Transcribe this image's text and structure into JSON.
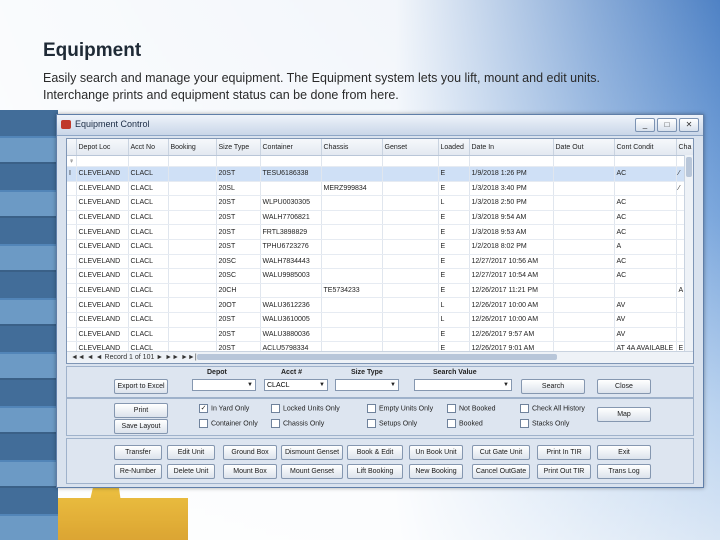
{
  "slide": {
    "title": "Equipment",
    "description": "Easily search and manage your equipment. The Equipment system lets you lift, mount and edit units. Interchange prints and equipment status can be done from here."
  },
  "window": {
    "title": "Equipment Control",
    "controls": [
      "_",
      "□",
      "✕"
    ]
  },
  "grid": {
    "columns": [
      "",
      "Depot Loc",
      "Acct No",
      "Booking",
      "Size Type",
      "Container",
      "Chassis",
      "Genset",
      "Loaded",
      "Date In",
      "Date Out",
      "Cont Condit",
      "Cha"
    ],
    "filter_marker": "♀",
    "rows": [
      [
        "I",
        "CLEVELAND",
        "CLACL",
        "",
        "20ST",
        "TESU6186338",
        "",
        "",
        "E",
        "1/9/2018 1:26 PM",
        "",
        "AC",
        "⁄"
      ],
      [
        "",
        "CLEVELAND",
        "CLACL",
        "",
        "20SL",
        "",
        "MERZ999834",
        "",
        "E",
        "1/3/2018 3:40 PM",
        "",
        "",
        "⁄"
      ],
      [
        "",
        "CLEVELAND",
        "CLACL",
        "",
        "20ST",
        "WLPU0030305",
        "",
        "",
        "L",
        "1/3/2018 2:50 PM",
        "",
        "AC",
        ""
      ],
      [
        "",
        "CLEVELAND",
        "CLACL",
        "",
        "20ST",
        "WALH7706821",
        "",
        "",
        "E",
        "1/3/2018 9:54 AM",
        "",
        "AC",
        ""
      ],
      [
        "",
        "CLEVELAND",
        "CLACL",
        "",
        "20ST",
        "FRTL3898829",
        "",
        "",
        "E",
        "1/3/2018 9:53 AM",
        "",
        "AC",
        ""
      ],
      [
        "",
        "CLEVELAND",
        "CLACL",
        "",
        "20ST",
        "TPHU6723276",
        "",
        "",
        "E",
        "1/2/2018 8:02 PM",
        "",
        "A",
        ""
      ],
      [
        "",
        "CLEVELAND",
        "CLACL",
        "",
        "20SC",
        "WALH7834443",
        "",
        "",
        "E",
        "12/27/2017 10:56 AM",
        "",
        "AC",
        ""
      ],
      [
        "",
        "CLEVELAND",
        "CLACL",
        "",
        "20SC",
        "WALU9985003",
        "",
        "",
        "E",
        "12/27/2017 10:54 AM",
        "",
        "AC",
        ""
      ],
      [
        "",
        "CLEVELAND",
        "CLACL",
        "",
        "20CH",
        "",
        "TE5734233",
        "",
        "E",
        "12/26/2017 11:21 PM",
        "",
        "",
        "A"
      ],
      [
        "",
        "CLEVELAND",
        "CLACL",
        "",
        "20OT",
        "WALU3612236",
        "",
        "",
        "L",
        "12/26/2017 10:00 AM",
        "",
        "AV",
        ""
      ],
      [
        "",
        "CLEVELAND",
        "CLACL",
        "",
        "20ST",
        "WALU3610005",
        "",
        "",
        "L",
        "12/26/2017 10:00 AM",
        "",
        "AV",
        ""
      ],
      [
        "",
        "CLEVELAND",
        "CLACL",
        "",
        "20ST",
        "WALU3880036",
        "",
        "",
        "E",
        "12/26/2017 9:57 AM",
        "",
        "AV",
        ""
      ],
      [
        "",
        "CLEVELAND",
        "CLACL",
        "",
        "20ST",
        "ACLU5798334",
        "",
        "",
        "E",
        "12/26/2017 9:01 AM",
        "",
        "AT 4A AVAILABLE",
        "E"
      ]
    ],
    "nav_text": "◄◄ ◄ ◄  Record 1 of 101 ► ►► ►►|  ◄"
  },
  "search": {
    "export_label": "Export to Excel",
    "depot_label": "Depot",
    "acct_label": "Acct #",
    "acct_value": "CLACL",
    "size_type_label": "Size Type",
    "search_value_label": "Search Value",
    "search_label": "Search",
    "close_label": "Close"
  },
  "options": {
    "print_label": "Print",
    "save_layout_label": "Save Layout",
    "map_label": "Map",
    "checks": [
      {
        "label": "In Yard Only",
        "checked": true
      },
      {
        "label": "Locked Units Only",
        "checked": false
      },
      {
        "label": "Empty Units Only",
        "checked": false
      },
      {
        "label": "Not Booked",
        "checked": false
      },
      {
        "label": "Check All History",
        "checked": false
      },
      {
        "label": "Container Only",
        "checked": false
      },
      {
        "label": "Chassis Only",
        "checked": false
      },
      {
        "label": "Setups Only",
        "checked": false
      },
      {
        "label": "Booked",
        "checked": false
      },
      {
        "label": "Stacks Only",
        "checked": false
      }
    ]
  },
  "actions": {
    "row1": [
      "Transfer",
      "Edit Unit",
      "Ground Box",
      "Dismount Genset",
      "Book & Edit",
      "Un Book Unit",
      "Cut Gate Unit",
      "Print In TIR",
      "Exit"
    ],
    "row2": [
      "Re-Number",
      "Delete Unit",
      "Mount Box",
      "Mount Genset",
      "Lift Booking",
      "New Booking",
      "Cancel OutGate",
      "Print Out TIR",
      "Trans Log"
    ]
  }
}
